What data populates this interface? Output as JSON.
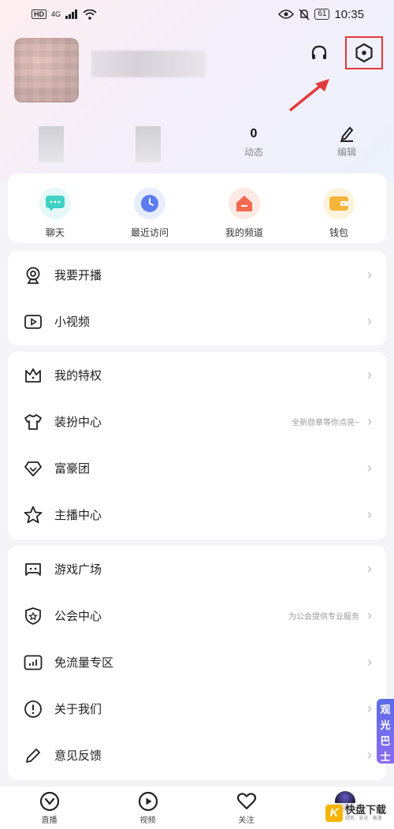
{
  "status_bar": {
    "hd": "HD",
    "network": "4G",
    "battery": "61",
    "time": "10:35"
  },
  "stats": {
    "moments_count": "0",
    "moments_label": "动态",
    "edit_label": "编辑"
  },
  "quick_actions": [
    {
      "label": "聊天",
      "icon": "chat-bubble-icon",
      "color": "#3fd2c5"
    },
    {
      "label": "最近访问",
      "icon": "clock-icon",
      "color": "#5b7bf0"
    },
    {
      "label": "我的频道",
      "icon": "house-icon",
      "color": "#f26a4f"
    },
    {
      "label": "钱包",
      "icon": "wallet-icon",
      "color": "#f5b43a"
    }
  ],
  "menu_group_1": [
    {
      "label": "我要开播",
      "icon": "webcam-icon"
    },
    {
      "label": "小视频",
      "icon": "play-square-icon"
    }
  ],
  "menu_group_2": [
    {
      "label": "我的特权",
      "icon": "crown-icon",
      "hint": ""
    },
    {
      "label": "装扮中心",
      "icon": "shirt-icon",
      "hint": "全新勋章等你点亮~"
    },
    {
      "label": "富豪团",
      "icon": "diamond-icon",
      "hint": ""
    },
    {
      "label": "主播中心",
      "icon": "star-icon",
      "hint": ""
    }
  ],
  "menu_group_3": [
    {
      "label": "游戏广场",
      "icon": "gamepad-icon",
      "hint": ""
    },
    {
      "label": "公会中心",
      "icon": "shield-star-icon",
      "hint": "为公会提供专业服务"
    },
    {
      "label": "免流量专区",
      "icon": "signal-chart-icon",
      "hint": ""
    },
    {
      "label": "关于我们",
      "icon": "info-circle-icon",
      "hint": ""
    },
    {
      "label": "意见反馈",
      "icon": "pencil-icon",
      "hint": ""
    }
  ],
  "side_badge": "观光巴士",
  "bottom_nav": [
    {
      "label": "直播",
      "icon": "live-icon"
    },
    {
      "label": "视频",
      "icon": "video-icon"
    },
    {
      "label": "关注",
      "icon": "heart-icon"
    },
    {
      "label": "",
      "icon": "avatar"
    }
  ],
  "watermark": {
    "logo": "K",
    "title": "快盘下载",
    "sub": "绿色 · 安全 · 高速"
  },
  "colors": {
    "annotation_red": "#e03a3a",
    "chevron": "#bbbbbb"
  }
}
